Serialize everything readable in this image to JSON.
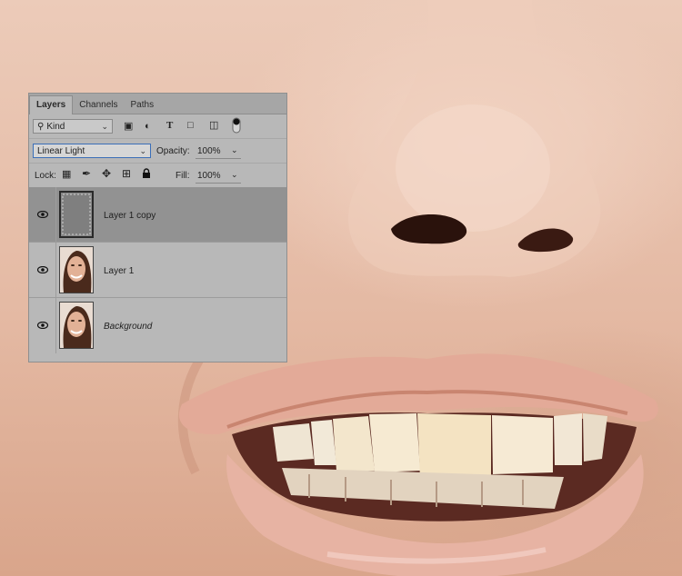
{
  "layers_panel": {
    "tabs": [
      "Layers",
      "Channels",
      "Paths"
    ],
    "filter": {
      "label": "Kind",
      "icons": [
        "image-filter-icon",
        "adjustment-filter-icon",
        "type-filter-icon",
        "shape-filter-icon",
        "smart-object-filter-icon",
        "filter-toggle-icon"
      ]
    },
    "blend_mode": "Linear Light",
    "opacity_label": "Opacity:",
    "opacity_value": "100%",
    "lock_label": "Lock:",
    "lock_icons": [
      "lock-transparent-icon",
      "lock-image-icon",
      "lock-position-icon",
      "lock-artboard-icon",
      "lock-all-icon"
    ],
    "fill_label": "Fill:",
    "fill_value": "100%",
    "layers": [
      {
        "name": "Layer 1 copy",
        "selected": true,
        "visible": true,
        "thumb": "gray"
      },
      {
        "name": "Layer 1",
        "selected": false,
        "visible": true,
        "thumb": "face"
      },
      {
        "name": "Background",
        "selected": false,
        "visible": true,
        "thumb": "face"
      }
    ]
  },
  "canvas": {
    "subject": "close-up of nose and smiling mouth"
  },
  "colors": {
    "panel_bg": "#b8b8b8",
    "selected_layer": "#929292",
    "tab_bar": "#a6a6a6"
  }
}
